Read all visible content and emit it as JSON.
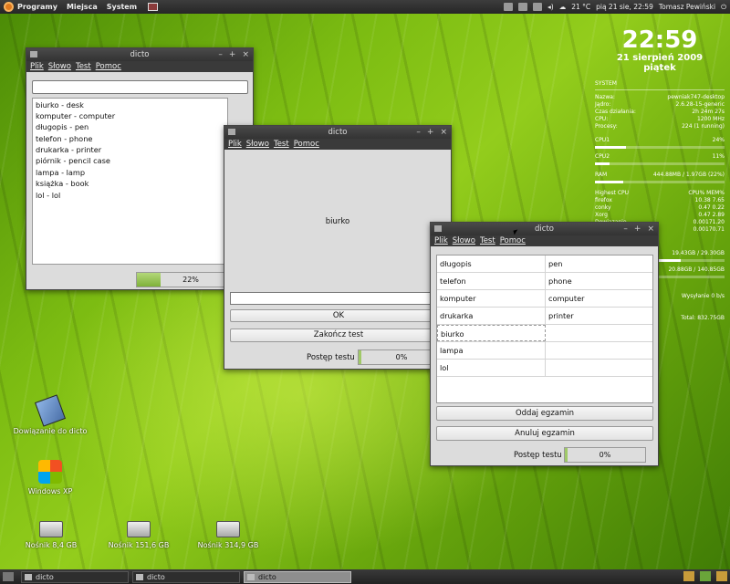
{
  "topbar": {
    "menus": [
      "Programy",
      "Miejsca",
      "System"
    ],
    "temperature": "21 °C",
    "datetime": "pią 21 sie, 22:59",
    "user": "Tomasz Pewiński"
  },
  "taskbar": {
    "items": [
      {
        "label": "dicto",
        "active": false
      },
      {
        "label": "dicto",
        "active": false
      },
      {
        "label": "dicto",
        "active": true
      }
    ]
  },
  "window_main": {
    "title": "dicto",
    "menu": [
      "Plik",
      "Słowo",
      "Test",
      "Pomoc"
    ],
    "words": [
      "biurko - desk",
      "komputer - computer",
      "długopis - pen",
      "telefon - phone",
      "drukarka - printer",
      "piórnik - pencil case",
      "lampa - lamp",
      "książka - book",
      "lol - lol"
    ],
    "progress_text": "22%",
    "progress_value": 0.22
  },
  "window_test": {
    "title": "dicto",
    "menu": [
      "Plik",
      "Słowo",
      "Test",
      "Pomoc"
    ],
    "current_word": "biurko",
    "ok_label": "OK",
    "end_label": "Zakończ test",
    "progress_label": "Postęp testu",
    "progress_text": "0%"
  },
  "window_exam": {
    "title": "dicto",
    "menu": [
      "Plik",
      "Słowo",
      "Test",
      "Pomoc"
    ],
    "rows": [
      {
        "pl": "długopis",
        "en": "pen"
      },
      {
        "pl": "telefon",
        "en": "phone"
      },
      {
        "pl": "komputer",
        "en": "computer"
      },
      {
        "pl": "drukarka",
        "en": "printer"
      },
      {
        "pl": "biurko",
        "en": ""
      },
      {
        "pl": "lampa",
        "en": ""
      },
      {
        "pl": "lol",
        "en": ""
      }
    ],
    "submit_label": "Oddaj egzamin",
    "cancel_label": "Anuluj egzamin",
    "progress_label": "Postęp testu",
    "progress_text": "0%"
  },
  "conky": {
    "time": "22:59",
    "date": "21 sierpień 2009",
    "day": "piątek",
    "system_header": "SYSTEM",
    "sys_rows": [
      {
        "k": "Nazwa:",
        "v": "pewniak747-desktop"
      },
      {
        "k": "Jądro:",
        "v": "2.6.28-15-generic"
      },
      {
        "k": "Czas działania:",
        "v": "2h 24m 27s"
      },
      {
        "k": "CPU:",
        "v": "1200 MHz"
      },
      {
        "k": "Procesy:",
        "v": "224 (1 running)"
      }
    ],
    "cpu1": {
      "label": "CPU1",
      "value": "24%",
      "level": 0.24
    },
    "cpu2": {
      "label": "CPU2",
      "value": "11%",
      "level": 0.11
    },
    "ram": {
      "label": "RAM",
      "value": "444.88MB / 1.97GB (22%)",
      "level": 0.22
    },
    "highest_header": "Highest CPU",
    "highest_cols": "CPU% MEM%",
    "procs": [
      {
        "k": "firefox",
        "v": "10.38   7.65"
      },
      {
        "k": "conky",
        "v": "0.47   0.22"
      },
      {
        "k": "Xorg",
        "v": "0.47   2.89"
      },
      {
        "k": "Dowiązanie",
        "v": "0.00171.20"
      },
      {
        "k": "",
        "v": "0.00170.71"
      }
    ],
    "disk1": "19.43GB / 29.30GB",
    "disk2": "20.88GB / 140.85GB",
    "upload": "Wysyłanie 0 b/s",
    "total": "Total: 832.75GB"
  },
  "desktop_icons": [
    {
      "label": "Dowiązanie do dicto"
    },
    {
      "label": "Windows XP"
    },
    {
      "label": "Nośnik 8,4 GB"
    },
    {
      "label": "Nośnik 151,6 GB"
    },
    {
      "label": "Nośnik 314,9 GB"
    }
  ]
}
